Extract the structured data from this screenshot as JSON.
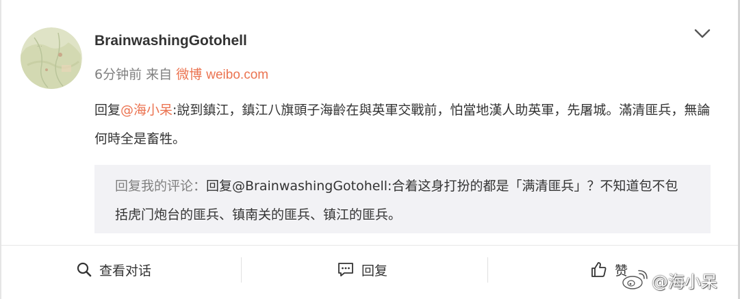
{
  "post": {
    "username": "BrainwashingGotohell",
    "time": "6分钟前",
    "from_label": "来自",
    "source": "微博",
    "source_site": "weibo.com",
    "body": {
      "prefix": "回复",
      "mention": "@海小呆",
      "text": ":說到鎮江，鎮江八旗頭子海齡在與英軍交戰前，怕當地漢人助英軍，先屠城。滿清匪兵，無論何時全是畜牲。"
    },
    "quoted": {
      "label": "回复我的评论：",
      "text": "回复@BrainwashingGotohell:合着这身打扮的都是「满清匪兵」？不知道包不包括虎门炮台的匪兵、镇南关的匪兵、镇江的匪兵。"
    }
  },
  "actions": {
    "view_conversation": "查看对话",
    "reply": "回复",
    "like": "赞"
  },
  "watermark": "@海小呆",
  "icons": {
    "avatar": "avatar-map-image",
    "menu": "chevron-down-icon",
    "view": "search-icon",
    "reply": "comment-icon",
    "like": "thumbs-up-icon",
    "watermark": "weibo-logo-icon"
  },
  "colors": {
    "accent": "#eb7350",
    "text": "#333333",
    "muted": "#808080",
    "quote_bg": "#f2f2f5"
  }
}
